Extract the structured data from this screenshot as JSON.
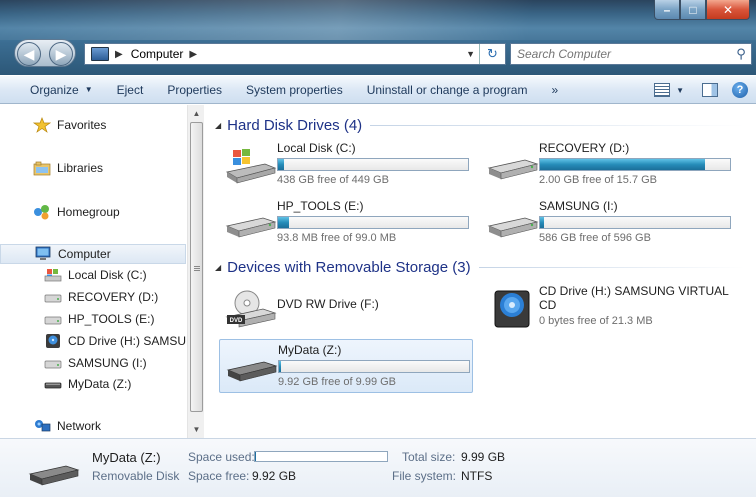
{
  "window": {
    "title": "Computer"
  },
  "nav": {
    "breadcrumb": "Computer",
    "search_placeholder": "Search Computer"
  },
  "toolbar": {
    "organize": "Organize",
    "eject": "Eject",
    "properties": "Properties",
    "system_properties": "System properties",
    "uninstall": "Uninstall or change a program",
    "more": "»"
  },
  "sidebar": {
    "favorites": "Favorites",
    "libraries": "Libraries",
    "homegroup": "Homegroup",
    "computer": "Computer",
    "drives": [
      {
        "label": "Local Disk (C:)",
        "icon": "windows-drive-icon"
      },
      {
        "label": "RECOVERY (D:)",
        "icon": "hard-drive-icon"
      },
      {
        "label": "HP_TOOLS (E:)",
        "icon": "hard-drive-icon"
      },
      {
        "label": "CD Drive (H:) SAMSUN",
        "icon": "cd-drive-icon"
      },
      {
        "label": "SAMSUNG (I:)",
        "icon": "hard-drive-icon"
      },
      {
        "label": "MyData (Z:)",
        "icon": "removable-disk-icon"
      }
    ],
    "network": "Network"
  },
  "groups": {
    "hdd": "Hard Disk Drives (4)",
    "removable": "Devices with Removable Storage (3)"
  },
  "hard_drives": [
    {
      "name": "Local Disk (C:)",
      "free": "438 GB free of 449 GB",
      "used_fraction": 0.03
    },
    {
      "name": "RECOVERY (D:)",
      "free": "2.00 GB free of 15.7 GB",
      "used_fraction": 0.87
    },
    {
      "name": "HP_TOOLS (E:)",
      "free": "93.8 MB free of 99.0 MB",
      "used_fraction": 0.06
    },
    {
      "name": "SAMSUNG (I:)",
      "free": "586 GB free of 596 GB",
      "used_fraction": 0.02
    }
  ],
  "removable": [
    {
      "name": "DVD RW Drive (F:)"
    },
    {
      "name": "CD Drive (H:) SAMSUNG VIRTUAL",
      "name2": "CD",
      "free": "0 bytes free of 21.3 MB"
    },
    {
      "name": "MyData (Z:)",
      "free": "9.92 GB free of 9.99 GB",
      "used_fraction": 0.01
    }
  ],
  "details": {
    "name": "MyData (Z:)",
    "type": "Removable Disk",
    "space_used_label": "Space used:",
    "space_free_label": "Space free:",
    "space_free": "9.92 GB",
    "total_size_label": "Total size:",
    "total_size": "9.99 GB",
    "filesystem_label": "File system:",
    "filesystem": "NTFS",
    "used_fraction": 0.01
  }
}
